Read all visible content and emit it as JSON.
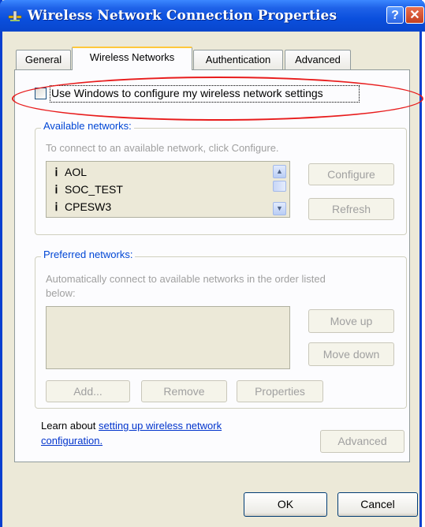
{
  "window": {
    "title": "Wireless Network Connection Properties",
    "help_glyph": "?",
    "close_glyph": "✕"
  },
  "tabs": [
    {
      "label": "General"
    },
    {
      "label": "Wireless Networks"
    },
    {
      "label": "Authentication"
    },
    {
      "label": "Advanced"
    }
  ],
  "use_windows": {
    "label": "Use Windows to configure my wireless network settings",
    "checked": false
  },
  "available": {
    "title": "Available networks:",
    "hint": "To connect to an available network, click Configure.",
    "networks": [
      "AOL",
      "SOC_TEST",
      "CPESW3"
    ],
    "configure_label": "Configure",
    "refresh_label": "Refresh",
    "scroll_up_glyph": "▲",
    "scroll_down_glyph": "▼"
  },
  "preferred": {
    "title": "Preferred networks:",
    "hint_line1": "Automatically connect to available networks in the order listed",
    "hint_line2": "below:",
    "move_up_label": "Move up",
    "move_down_label": "Move down",
    "add_label": "Add...",
    "remove_label": "Remove",
    "properties_label": "Properties"
  },
  "learn": {
    "prefix": "Learn about ",
    "link_line1": "setting up wireless network",
    "link_line2": "configuration.",
    "advanced_label": "Advanced"
  },
  "footer": {
    "ok_label": "OK",
    "cancel_label": "Cancel"
  },
  "colors": {
    "titlebar": "#0a4fdd",
    "highlight_ellipse": "#e81c1c",
    "group_title": "#0046d5"
  },
  "icons": {
    "title": "network-connection-icon",
    "network": "antenna-icon"
  }
}
